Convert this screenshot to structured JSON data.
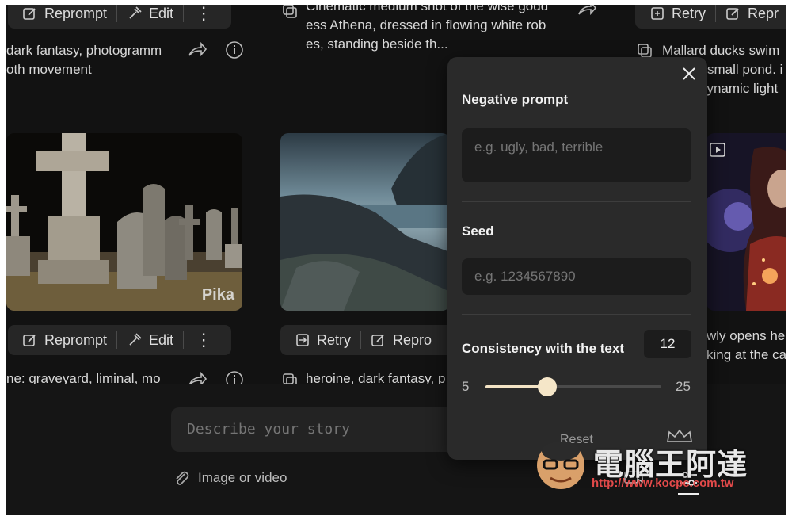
{
  "cards": {
    "top_left": {
      "reprompt": "Reprompt",
      "edit": "Edit",
      "caption_line1": "dark fantasy, photogramm",
      "caption_line2": "oth movement"
    },
    "top_middle": {
      "caption_line0": "Cinematic medium shot of the wise godd",
      "caption_line1": "ess Athena, dressed in flowing white rob",
      "caption_line2": "es, standing beside th..."
    },
    "top_right": {
      "retry": "Retry",
      "reprompt": "Repr",
      "caption_line1": "Mallard ducks swim",
      "caption_line2": "small pond. i",
      "caption_line3": "dynamic light"
    },
    "bottom_left": {
      "watermark": "Pika",
      "reprompt": "Reprompt",
      "edit": "Edit",
      "caption": "ne: graveyard, liminal, mo"
    },
    "bottom_middle": {
      "retry": "Retry",
      "reprompt": "Repro",
      "caption": "heroine, dark fantasy, p"
    },
    "bottom_right": {
      "caption_line1": "wly opens her",
      "caption_line2": "king at the ca"
    }
  },
  "settings_panel": {
    "negative_prompt_label": "Negative prompt",
    "negative_prompt_placeholder": "e.g. ugly, bad, terrible",
    "seed_label": "Seed",
    "seed_placeholder": "e.g. 1234567890",
    "consistency_label": "Consistency with the text",
    "consistency_value": "12",
    "slider_min": "5",
    "slider_max": "25",
    "slider_value": 12,
    "reset_label": "Reset"
  },
  "composer": {
    "placeholder": "Describe your story",
    "attach_label": "Image or video"
  },
  "watermark": {
    "title": "電腦王阿達",
    "url": "http://www.kocpc.com.tw"
  },
  "colors": {
    "background": "#121212",
    "panel": "#2a2a2a",
    "slider_accent": "#f3e3c4"
  }
}
